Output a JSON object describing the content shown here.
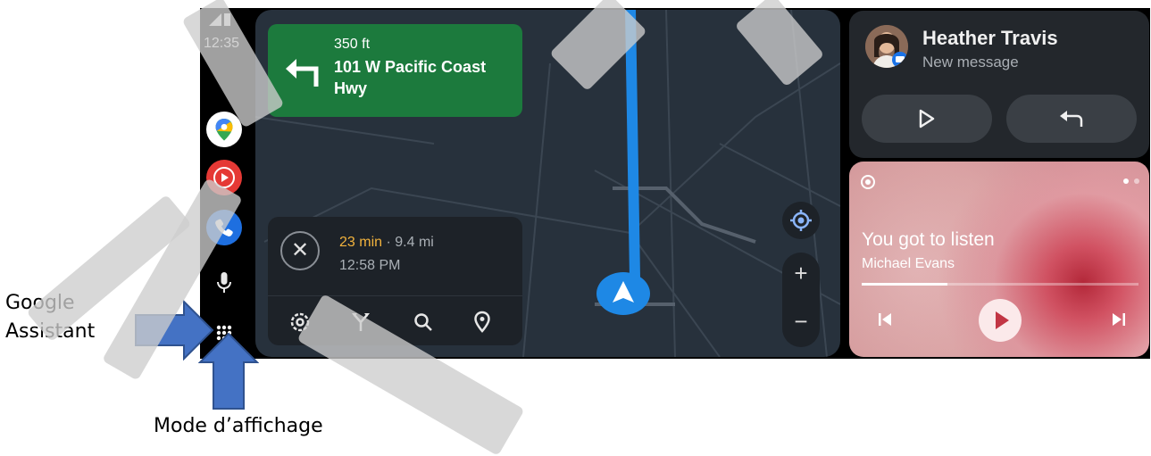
{
  "status": {
    "clock": "12:35"
  },
  "rail": {
    "apps": [
      "maps-icon",
      "youtube-music-icon",
      "phone-icon"
    ],
    "assistant_icon": "microphone-icon",
    "launcher_icon": "app-grid-icon"
  },
  "navigation": {
    "distance": "350 ft",
    "street": "101 W Pacific Coast Hwy",
    "eta_minutes": "23 min",
    "eta_rest": " · 9.4 mi",
    "arrival_time": "12:58 PM",
    "zoom_in_label": "+",
    "zoom_out_label": "−",
    "close_label": "✕"
  },
  "message": {
    "contact": "Heather Travis",
    "subtitle": "New message"
  },
  "media": {
    "title": "You got to listen",
    "artist": "Michael Evans",
    "progress": 0.31
  },
  "annotations": {
    "assistant_label": "Google\nAssistant",
    "display_mode_label": "Mode d’affichage"
  },
  "colors": {
    "route_blue": "#1e88e5",
    "turn_card_green": "#1c7a3d",
    "eta_orange": "#f2b33d",
    "arrow_blue": "#4472c4"
  }
}
